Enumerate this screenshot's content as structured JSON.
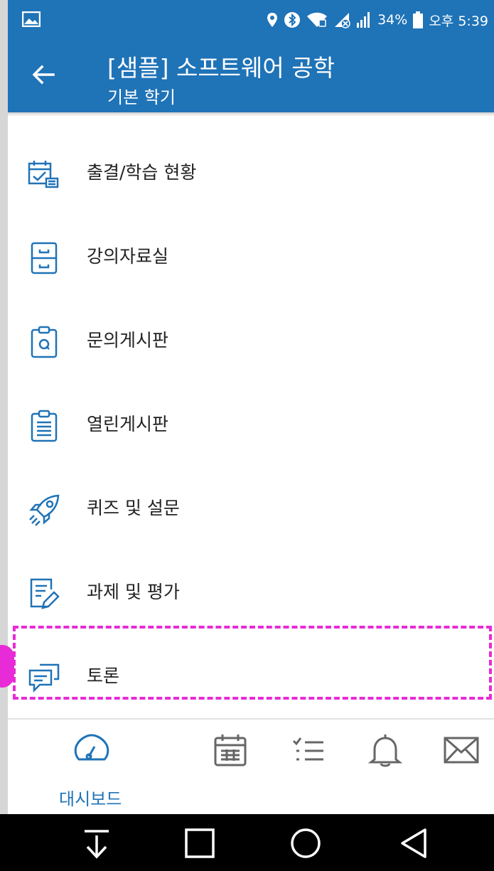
{
  "status": {
    "battery_percent": "34%",
    "time": "오후 5:39",
    "icons": [
      "image-icon",
      "location-icon",
      "bluetooth-icon",
      "wifi-icon",
      "data-off-icon",
      "signal-icon",
      "battery-icon"
    ]
  },
  "header": {
    "title": "[샘플] 소프트웨어 공학",
    "subtitle": "기본 학기",
    "back_icon": "back-arrow-icon"
  },
  "menu": {
    "items": [
      {
        "label": "출결/학습 현황",
        "icon": "attendance-icon"
      },
      {
        "label": "강의자료실",
        "icon": "archive-icon"
      },
      {
        "label": "문의게시판",
        "icon": "qna-board-icon"
      },
      {
        "label": "열린게시판",
        "icon": "clipboard-list-icon"
      },
      {
        "label": "퀴즈 및 설문",
        "icon": "rocket-icon"
      },
      {
        "label": "과제 및 평가",
        "icon": "assignment-edit-icon"
      },
      {
        "label": "토론",
        "icon": "discussion-icon"
      }
    ],
    "highlighted_item": "토론"
  },
  "bottom_nav": {
    "items": [
      {
        "label": "대시보드",
        "icon": "dashboard-gauge-icon",
        "active": true
      },
      {
        "label": "",
        "icon": "calendar-icon",
        "active": false
      },
      {
        "label": "",
        "icon": "checklist-icon",
        "active": false
      },
      {
        "label": "",
        "icon": "bell-icon",
        "active": false
      },
      {
        "label": "",
        "icon": "mail-icon",
        "active": false
      }
    ]
  },
  "colors": {
    "primary": "#1f73b7",
    "highlight": "#e72bd6"
  }
}
